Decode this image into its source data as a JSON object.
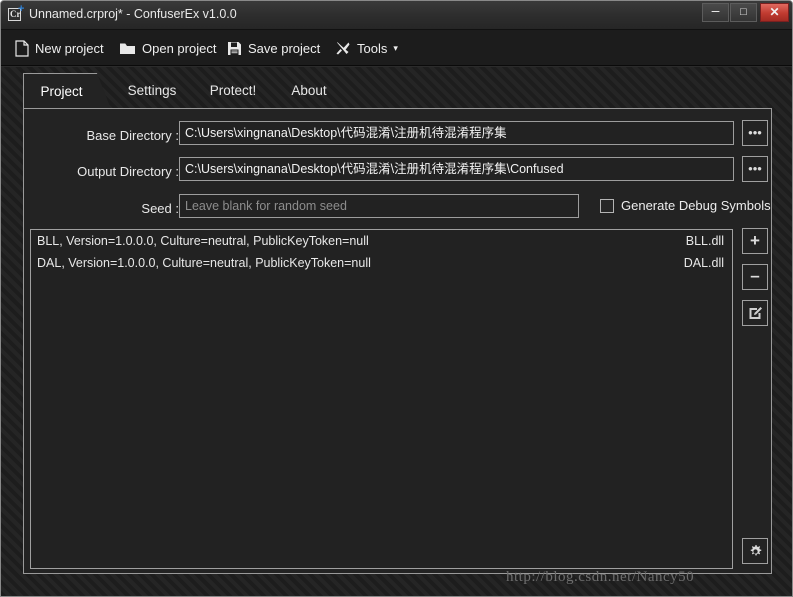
{
  "window": {
    "title": "Unnamed.crproj* - ConfuserEx v1.0.0",
    "icon_name": "confuserex-app-icon",
    "minimize_glyph": "–",
    "maximize_glyph": "□",
    "close_glyph": "✕"
  },
  "toolbar": {
    "items": [
      {
        "label": "New project",
        "icon": "document-icon"
      },
      {
        "label": "Open project",
        "icon": "folder-icon"
      },
      {
        "label": "Save project",
        "icon": "floppy-disk-icon"
      },
      {
        "label": "Tools",
        "icon": "tools-icon",
        "caret": "▾"
      }
    ]
  },
  "tabs": [
    {
      "label": "Project",
      "active": true
    },
    {
      "label": "Settings",
      "active": false
    },
    {
      "label": "Protect!",
      "active": false
    },
    {
      "label": "About",
      "active": false
    }
  ],
  "project": {
    "base_directory": {
      "label": "Base Directory :",
      "value": "C:\\Users\\xingnana\\Desktop\\代码混淆\\注册机待混淆程序集",
      "browse_label": "•••"
    },
    "output_directory": {
      "label": "Output Directory :",
      "value": "C:\\Users\\xingnana\\Desktop\\代码混淆\\注册机待混淆程序集\\Confused",
      "browse_label": "•••"
    },
    "seed": {
      "label": "Seed :",
      "value": "",
      "placeholder": "Leave blank for random seed"
    },
    "generate_debug_symbols": {
      "label": "Generate Debug Symbols",
      "checked": false
    },
    "assemblies": [
      {
        "name": "BLL, Version=1.0.0.0, Culture=neutral, PublicKeyToken=null",
        "file": "BLL.dll"
      },
      {
        "name": "DAL, Version=1.0.0.0, Culture=neutral, PublicKeyToken=null",
        "file": "DAL.dll"
      }
    ],
    "list_actions": {
      "add_label": "+",
      "remove_label": "–",
      "edit_label": "✎",
      "settings_label": "⚙"
    }
  },
  "watermark": "http://blog.csdn.net/Nancy50",
  "colors": {
    "window_bg": "#2b2b2b",
    "panel_bg": "#232323",
    "toolbar_bg": "#1c1c1c",
    "field_bg": "#222222",
    "border": "#9d9d9d",
    "text": "#e8e8e8",
    "placeholder": "#8d8d8d",
    "close_button": "#c03b30",
    "accent_blue": "#2f7fd0"
  }
}
